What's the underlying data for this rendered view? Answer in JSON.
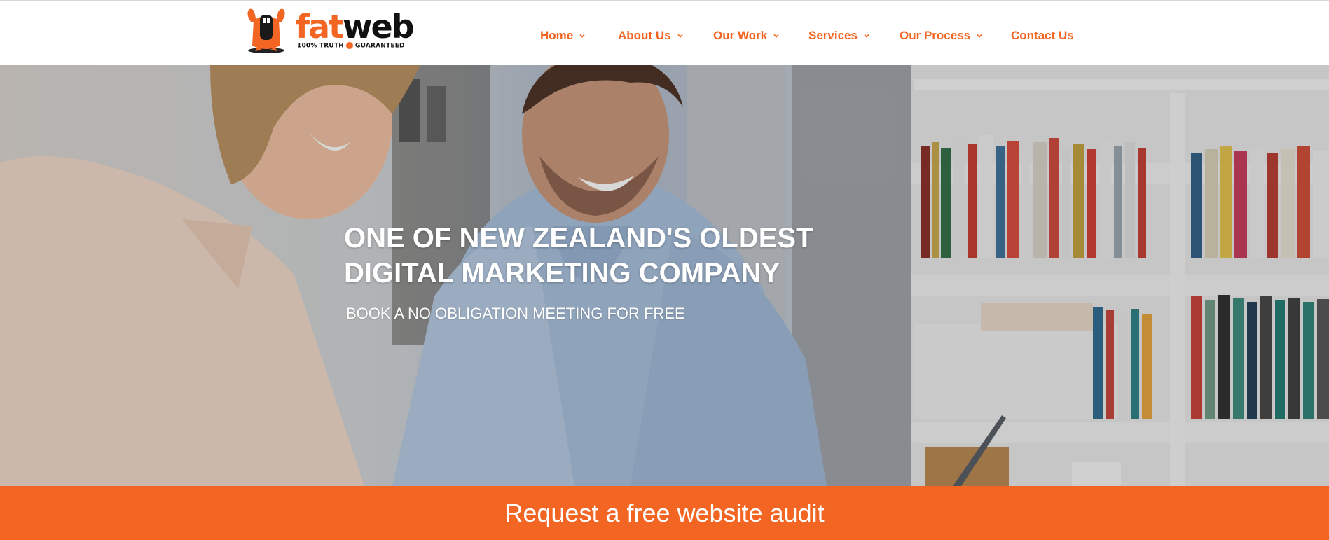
{
  "brand": {
    "logo_word_fat": "fat",
    "logo_word_web": "web",
    "logo_tag_left": "100% TRUTH",
    "logo_tag_right": "GUARANTEED",
    "accent_color": "#f26522"
  },
  "nav": {
    "items": [
      {
        "label": "Home",
        "has_dropdown": true
      },
      {
        "label": "About Us",
        "has_dropdown": true
      },
      {
        "label": "Our Work",
        "has_dropdown": true
      },
      {
        "label": "Services",
        "has_dropdown": true
      },
      {
        "label": "Our Process",
        "has_dropdown": true
      },
      {
        "label": "Contact Us",
        "has_dropdown": false
      }
    ]
  },
  "hero": {
    "title_line1": "ONE OF NEW ZEALAND'S OLDEST",
    "title_line2": "DIGITAL MARKETING COMPANY",
    "subtitle": "BOOK A NO OBLIGATION MEETING FOR FREE"
  },
  "cta": {
    "label": "Request a free website audit"
  }
}
